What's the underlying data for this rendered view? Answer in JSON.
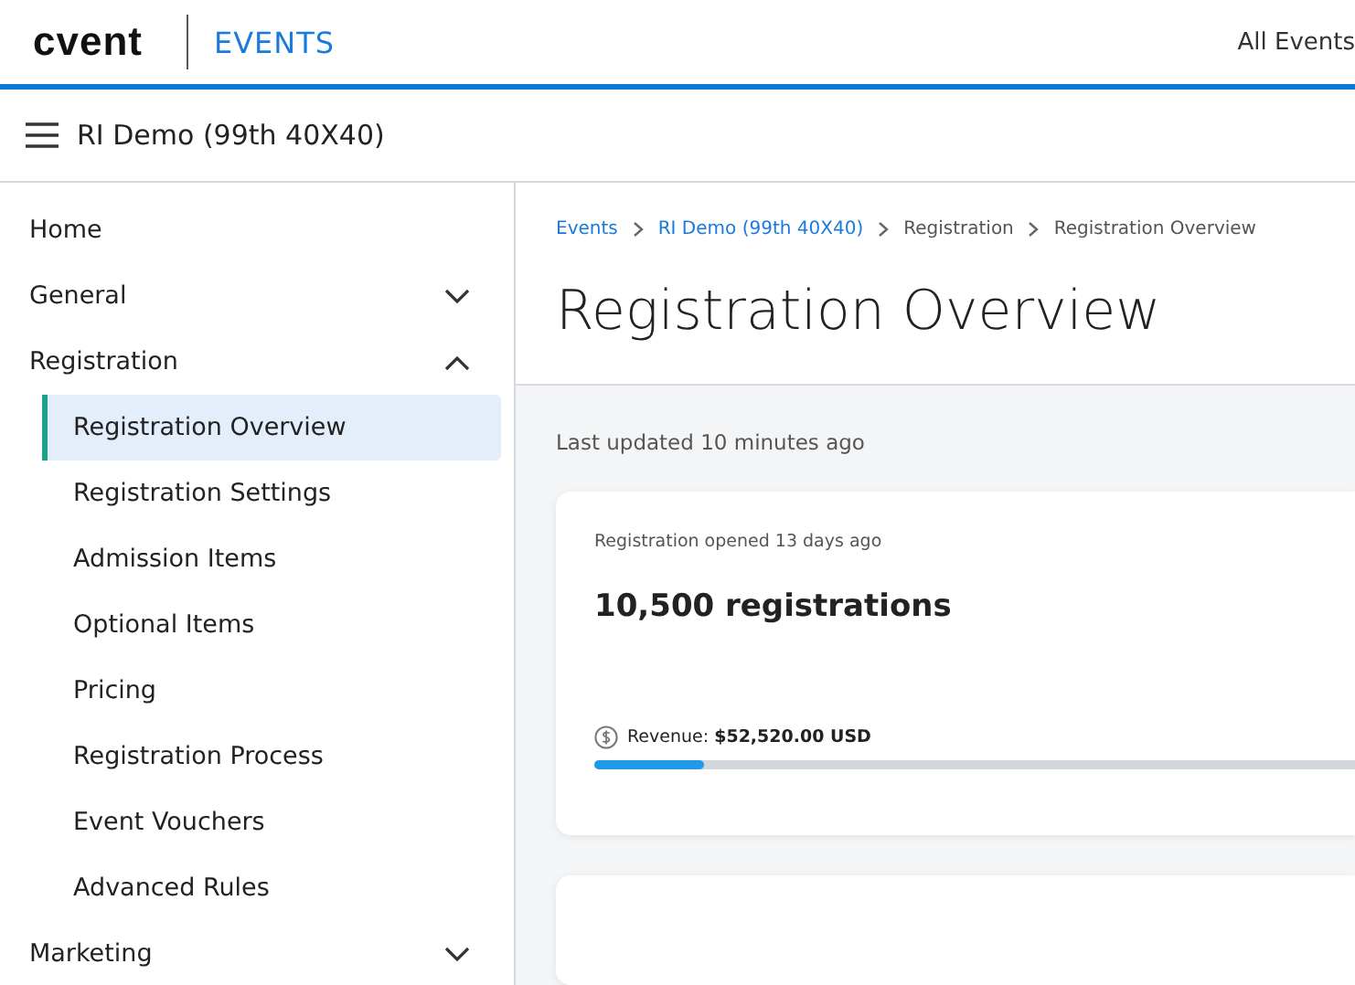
{
  "header": {
    "logo": "cvent",
    "product": "EVENTS",
    "link": "All Events"
  },
  "event_bar": {
    "title": "RI Demo (99th 40X40)"
  },
  "sidebar": {
    "items": [
      {
        "label": "Home",
        "selected": false
      },
      {
        "label": "General",
        "expanded": false,
        "selected": false
      },
      {
        "label": "Registration",
        "expanded": true,
        "selected": false,
        "children": [
          {
            "label": "Registration Overview",
            "selected": true
          },
          {
            "label": "Registration Settings",
            "selected": false
          },
          {
            "label": "Admission Items",
            "selected": false
          },
          {
            "label": "Optional Items",
            "selected": false
          },
          {
            "label": "Pricing",
            "selected": false
          },
          {
            "label": "Registration Process",
            "selected": false
          },
          {
            "label": "Event Vouchers",
            "selected": false
          },
          {
            "label": "Advanced Rules",
            "selected": false
          }
        ]
      },
      {
        "label": "Marketing",
        "expanded": false,
        "selected": false
      }
    ]
  },
  "breadcrumb": [
    {
      "label": "Events",
      "link": true
    },
    {
      "label": "RI Demo (99th 40X40)",
      "link": true
    },
    {
      "label": "Registration",
      "link": false
    },
    {
      "label": "Registration Overview",
      "link": false
    }
  ],
  "page_title": "Registration Overview",
  "last_updated": "Last updated 10 minutes ago",
  "summary_card": {
    "opened": "Registration opened 13 days ago",
    "count": "10,500 registrations",
    "revenue": "Revenue: **$52,520.00 USD**",
    "level": 0.13
  }
}
